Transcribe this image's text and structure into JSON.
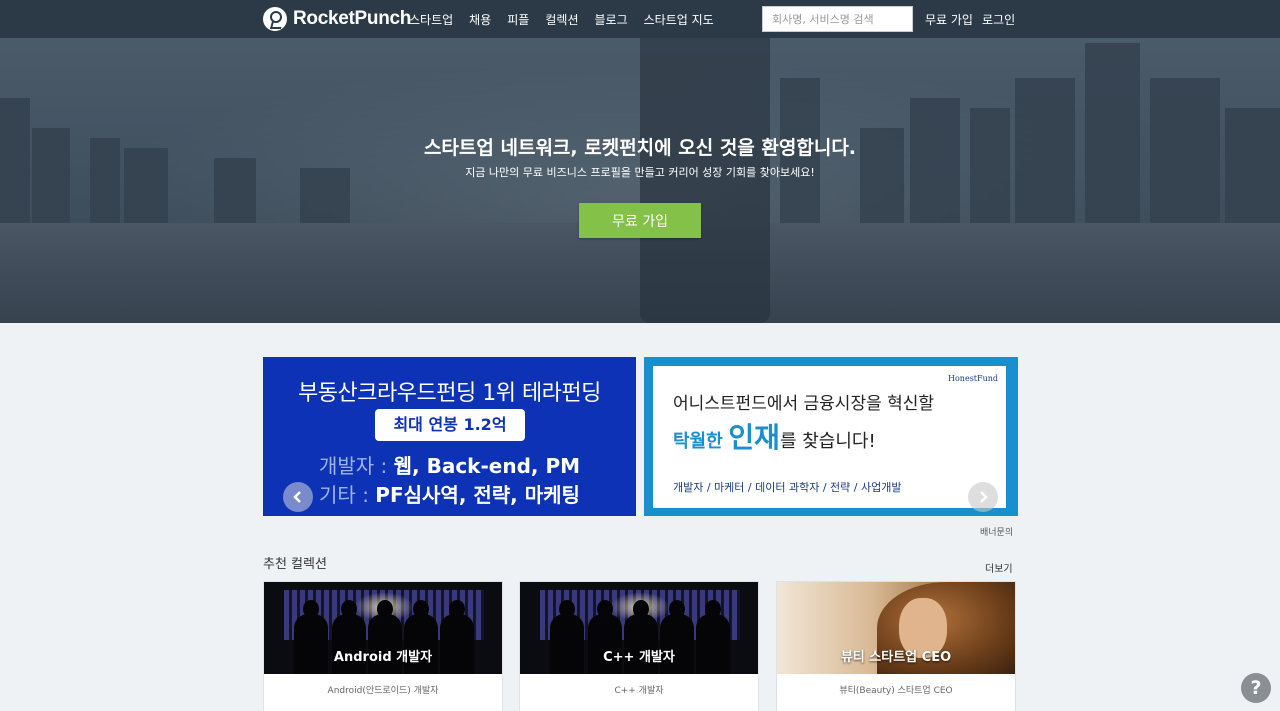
{
  "brand": {
    "name": "RocketPunch"
  },
  "nav": {
    "items": [
      {
        "label": "스타트업"
      },
      {
        "label": "채용"
      },
      {
        "label": "피플"
      },
      {
        "label": "컬렉션"
      },
      {
        "label": "블로그"
      },
      {
        "label": "스타트업 지도"
      }
    ],
    "search_placeholder": "회사명, 서비스명 검색",
    "search_value": "",
    "signup": "무료 가입",
    "login": "로그인"
  },
  "hero": {
    "title": "스타트업 네트워크, 로켓펀치에 오신 것을 환영합니다.",
    "subtitle": "지금 나만의 무료 비즈니스 프로필을 만들고 커리어 성장 기회를 찾아보세요!",
    "cta": "무료 가입"
  },
  "banners": {
    "left": {
      "title": "부동산크라우드펀딩 1위 테라펀딩",
      "pill": "최대 연봉 1.2억",
      "rows": [
        {
          "key": "개발자 :",
          "value": "웹, Back-end, PM"
        },
        {
          "key": "기타 :",
          "value": "PF심사역, 전략, 마케팅"
        }
      ]
    },
    "right": {
      "brand": "HonestFund",
      "line1": "어니스트펀드에서 금융시장을 혁신할",
      "line2_a": "탁월한",
      "line2_b": "인재",
      "line2_c": "를 찾습니다!",
      "tags": "개발자 / 마케터 / 데이터 과학자 / 전략 / 사업개발"
    },
    "inquiry": "배너문의"
  },
  "collections": {
    "title": "추천 컬렉션",
    "more": "더보기",
    "cards": [
      {
        "name": "Android 개발자",
        "desc": "Android(안드로이드) 개발자"
      },
      {
        "name": "C++ 개발자",
        "desc": "C++ 개발자"
      },
      {
        "name": "뷰티 스타트업 CEO",
        "desc": "뷰티(Beauty) 스타트업 CEO"
      }
    ]
  },
  "help": {
    "icon": "question-icon",
    "label": "?"
  },
  "colors": {
    "nav_bg": "#2c3a47",
    "cta_green": "#83c149",
    "banner_blue": "#0e32b5",
    "banner_frame": "#1a8fcf"
  }
}
